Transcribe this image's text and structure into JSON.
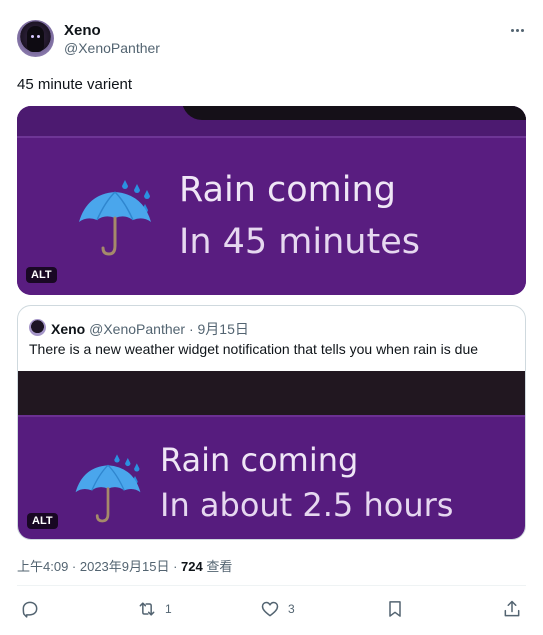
{
  "author": {
    "name": "Xeno",
    "handle": "@XenoPanther"
  },
  "tweet": {
    "text": "45 minute varient"
  },
  "media": {
    "line1": "Rain coming",
    "line2": "In 45 minutes",
    "alt_label": "ALT"
  },
  "quote": {
    "name": "Xeno",
    "handle": "@XenoPanther",
    "date": "· 9月15日",
    "text": "There is a new weather widget notification that tells you when rain is due",
    "line1": "Rain coming",
    "line2": "In about 2.5 hours",
    "alt_label": "ALT"
  },
  "meta": {
    "timestamp": "上午4:09 · 2023年9月15日 · ",
    "views_count": "724",
    "views_label": " 查看"
  },
  "actions": {
    "replies": "",
    "retweets": "1",
    "likes": "3"
  },
  "icons": {
    "more": "more-icon",
    "reply": "reply-icon",
    "retweet": "retweet-icon",
    "like": "heart-icon",
    "bookmark": "bookmark-icon",
    "share": "share-icon",
    "weather": "umbrella-rain-icon"
  },
  "colors": {
    "notification_bg": "#591d80",
    "text_primary": "#0f1419",
    "text_secondary": "#536471"
  }
}
